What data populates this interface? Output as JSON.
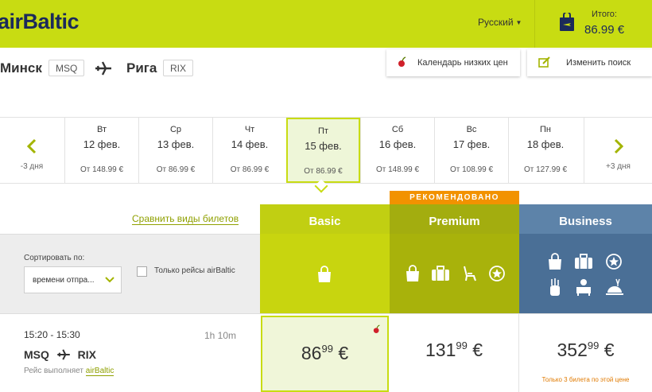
{
  "header": {
    "logo": "airBaltic",
    "language": "Русский",
    "total_label": "Итого:",
    "total_value": "86.99 €"
  },
  "route": {
    "from_city": "Минск",
    "from_code": "MSQ",
    "to_city": "Рига",
    "to_code": "RIX"
  },
  "actions": {
    "calendar": "Календарь низких цен",
    "modify": "Изменить поиск"
  },
  "date_strip": {
    "prev_label": "-3 дня",
    "next_label": "+3 дня",
    "days": [
      {
        "dow": "Вт",
        "date": "12 фев.",
        "price": "От 148.99 €"
      },
      {
        "dow": "Ср",
        "date": "13 фев.",
        "price": "От 86.99 €"
      },
      {
        "dow": "Чт",
        "date": "14 фев.",
        "price": "От 86.99 €"
      },
      {
        "dow": "Пт",
        "date": "15 фев.",
        "price": "От 86.99 €"
      },
      {
        "dow": "Сб",
        "date": "16 фев.",
        "price": "От 148.99 €"
      },
      {
        "dow": "Вс",
        "date": "17 фев.",
        "price": "От 108.99 €"
      },
      {
        "dow": "Пн",
        "date": "18 фев.",
        "price": "От 127.99 €"
      }
    ]
  },
  "fares": {
    "compare_link": "Сравнить виды билетов",
    "recommended_badge": "РЕКОМЕНДОВАНО",
    "basic": "Basic",
    "premium": "Premium",
    "business": "Business"
  },
  "sort": {
    "label": "Сортировать по:",
    "value": "времени отпра...",
    "filter_label": "Только рейсы airBaltic"
  },
  "flight": {
    "time": "15:20 - 15:30",
    "duration": "1h 10m",
    "from": "MSQ",
    "to": "RIX",
    "operated_prefix": "Рейс выполняет",
    "operator": "airBaltic",
    "basic_whole": "86",
    "basic_cents": "99",
    "premium_whole": "131",
    "premium_cents": "99",
    "business_whole": "352",
    "business_cents": "99",
    "currency": "€",
    "business_note": "Только 3 билета по этой цене"
  },
  "colors": {
    "brand_lime": "#c8dc12",
    "brand_navy": "#1b2a5a",
    "premium": "#a8b20b",
    "business": "#4a6f96",
    "recommended": "#f29200"
  }
}
